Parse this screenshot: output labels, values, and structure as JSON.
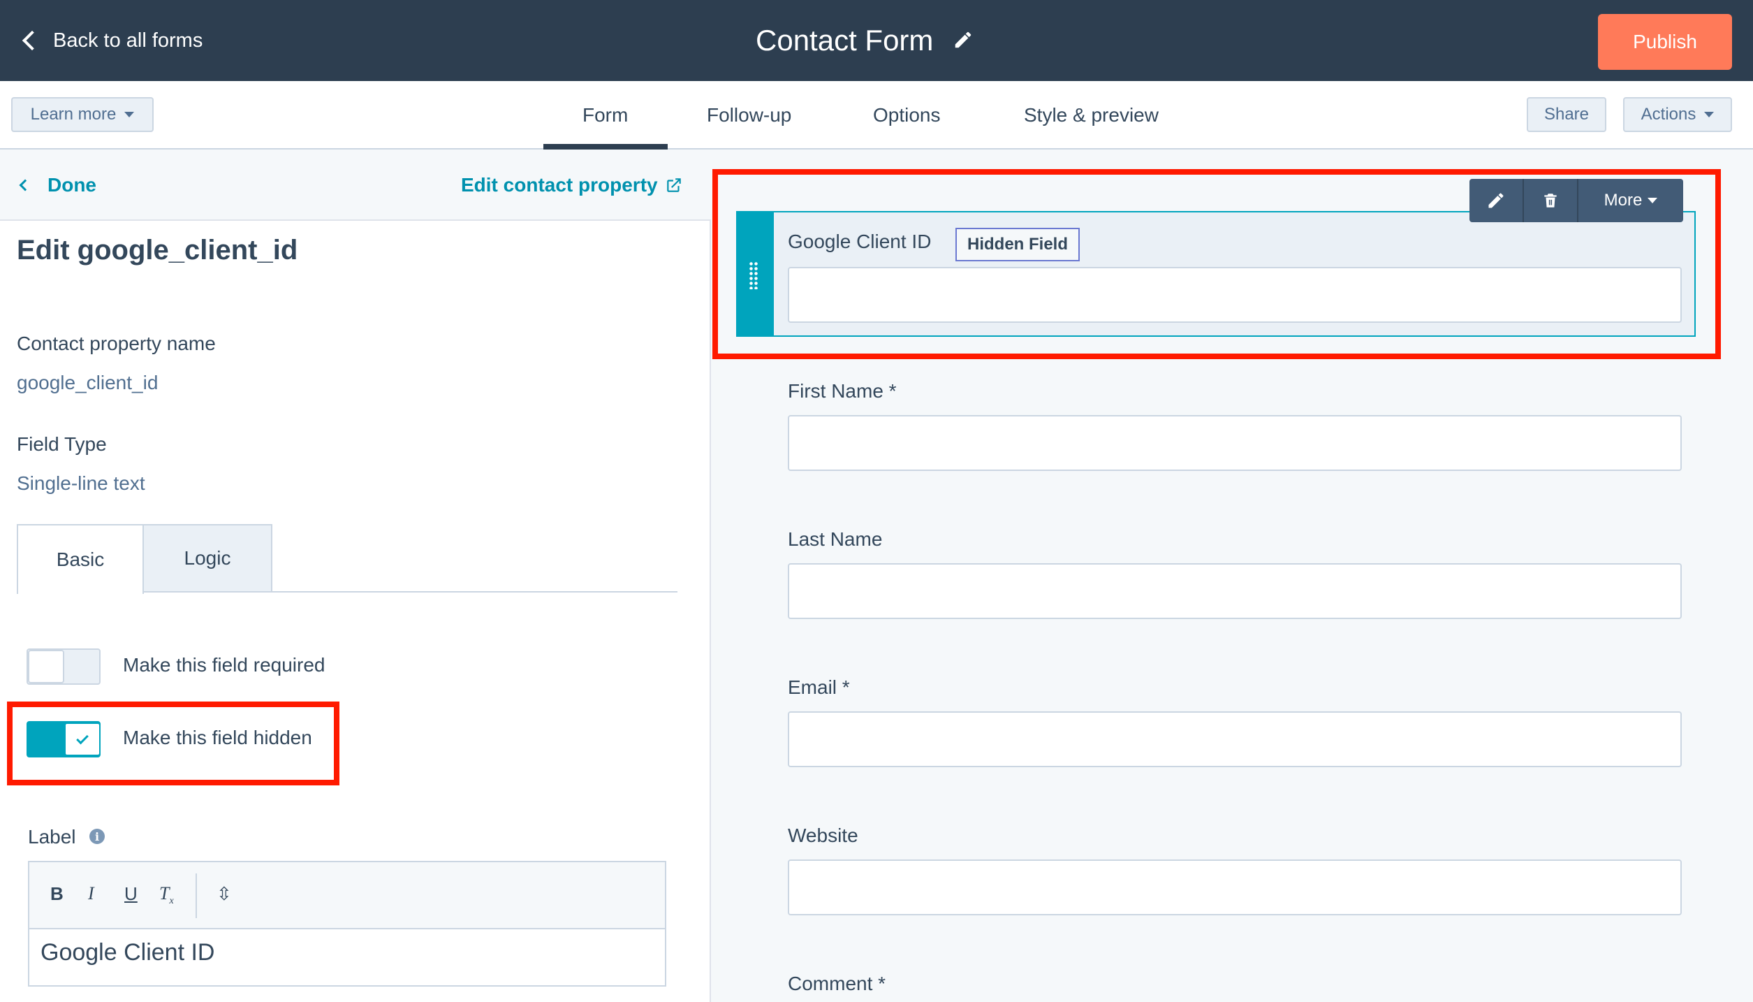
{
  "topbar": {
    "back_label": "Back to all forms",
    "form_title": "Contact Form",
    "publish_label": "Publish"
  },
  "subbar": {
    "learn_more": "Learn more",
    "tabs": [
      {
        "label": "Form",
        "active": true
      },
      {
        "label": "Follow-up",
        "active": false
      },
      {
        "label": "Options",
        "active": false
      },
      {
        "label": "Style & preview",
        "active": false
      }
    ],
    "share": "Share",
    "actions": "Actions"
  },
  "left": {
    "done": "Done",
    "edit_property": "Edit contact property",
    "heading": "Edit google_client_id",
    "property_name_label": "Contact property name",
    "property_name_value": "google_client_id",
    "field_type_label": "Field Type",
    "field_type_value": "Single-line text",
    "tabs": [
      {
        "label": "Basic",
        "active": true
      },
      {
        "label": "Logic",
        "active": false
      }
    ],
    "toggles": [
      {
        "label": "Make this field required",
        "on": false
      },
      {
        "label": "Make this field hidden",
        "on": true
      }
    ],
    "label_heading": "Label",
    "info_glyph": "i",
    "editor_tools": [
      "B",
      "I",
      "U",
      "T"
    ],
    "tool_sub": "x",
    "link_glyph": "⇳",
    "editor_value": "Google Client ID"
  },
  "right": {
    "card_actions": {
      "more": "More"
    },
    "selected_field": {
      "label": "Google Client ID",
      "badge": "Hidden Field"
    },
    "fields": [
      {
        "label": "First Name *"
      },
      {
        "label": "Last Name"
      },
      {
        "label": "Email *"
      },
      {
        "label": "Website"
      },
      {
        "label": "Comment *"
      }
    ]
  },
  "colors": {
    "topbar": "#2d3e50",
    "publish": "#ff7a59",
    "accent": "#00a4bd",
    "link": "#0091ae",
    "highlight": "#ff1a00"
  }
}
